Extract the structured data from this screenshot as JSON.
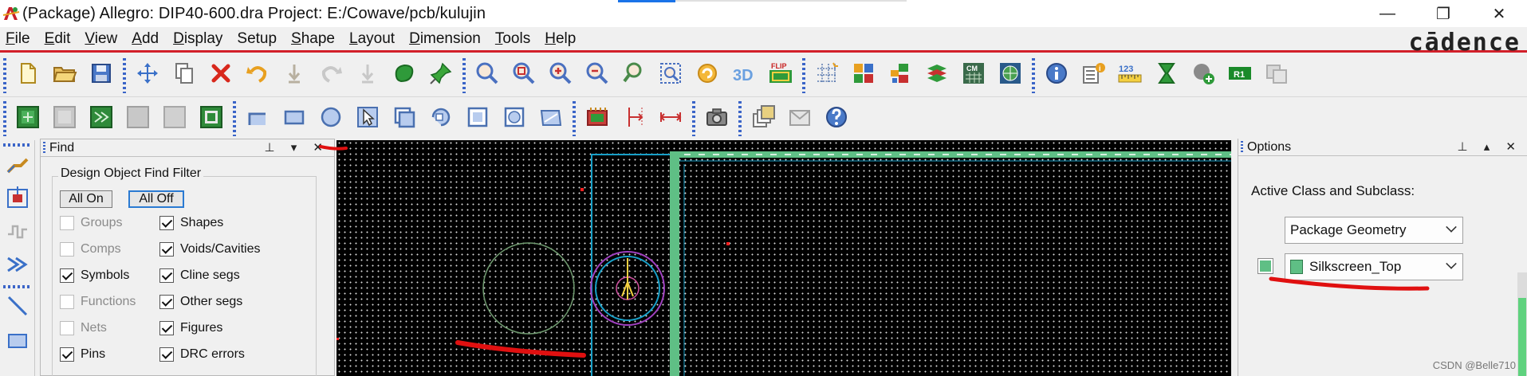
{
  "window": {
    "title": "(Package) Allegro: DIP40-600.dra  Project: E:/Cowave/pcb/kulujin",
    "minimize": "—",
    "restore": "❐",
    "close": "✕"
  },
  "menu": {
    "items": [
      {
        "label": "File",
        "accel": "F",
        "rest": "ile"
      },
      {
        "label": "Edit",
        "accel": "E",
        "rest": "dit"
      },
      {
        "label": "View",
        "accel": "V",
        "rest": "iew"
      },
      {
        "label": "Add",
        "accel": "A",
        "rest": "dd"
      },
      {
        "label": "Display",
        "accel": "D",
        "rest": "isplay"
      },
      {
        "label": "Setup",
        "accel": "",
        "rest": "Setup"
      },
      {
        "label": "Shape",
        "accel": "S",
        "rest": "hape"
      },
      {
        "label": "Layout",
        "accel": "L",
        "rest": "ayout"
      },
      {
        "label": "Dimension",
        "accel": "D",
        "rest": "imension"
      },
      {
        "label": "Tools",
        "accel": "T",
        "rest": "ools"
      },
      {
        "label": "Help",
        "accel": "H",
        "rest": "elp"
      }
    ],
    "brand": "cādence"
  },
  "toolbar1": {
    "icons": [
      "new-file-icon",
      "open-folder-icon",
      "save-icon",
      "move-icon",
      "copy-icon",
      "delete-icon",
      "undo-icon",
      "down-arrow-icon",
      "redo-icon",
      "down-arrow-icon",
      "green-blob-icon",
      "pin-icon",
      "zoom-fit-icon",
      "zoom-window-icon",
      "zoom-in-icon",
      "zoom-out-icon",
      "zoom-previous-icon",
      "zoom-world-icon",
      "redraw-icon",
      "3d-view-icon",
      "flip-icon",
      "grid-icon",
      "color-icon",
      "layers-icon",
      "stack-icon",
      "cm-icon",
      "world-icon",
      "info-icon",
      "properties-icon",
      "measure-123-icon",
      "hourglass-icon",
      "add-green-icon",
      "r1-icon",
      "disabled-icon"
    ],
    "label_3d": "3D",
    "label_flip": "FLIP",
    "label_cm": "CM",
    "label_123": "123",
    "label_r1": "R1"
  },
  "toolbar2": {
    "icons": [
      "place-green-icon",
      "place-gray-icon",
      "place-green2-icon",
      "place-gray2-icon",
      "place-gray3-icon",
      "place-green3-icon",
      "line-corner-icon",
      "rectangle-icon",
      "circle-icon",
      "select-arrow-icon",
      "shape-edit-icon",
      "rotate-shape-icon",
      "square-icon",
      "circle-square-icon",
      "shape-tool-icon",
      "component-icon",
      "dimension-vertical-icon",
      "dimension-horizontal-icon",
      "camera-icon",
      "multi-window-icon",
      "mail-icon",
      "help-icon"
    ]
  },
  "leftstrip": {
    "icons": [
      "route-icon",
      "place-icon",
      "signal-icon",
      "arrow-icon",
      "line-tool-icon",
      "rectangle-tool-icon"
    ]
  },
  "find": {
    "title": "Find",
    "controls": "⊥ ▾ ✕",
    "group_label": "Design Object Find Filter",
    "all_on": "All On",
    "all_off": "All Off",
    "left_col": [
      {
        "label": "Groups",
        "checked": false,
        "enabled": false
      },
      {
        "label": "Comps",
        "checked": false,
        "enabled": false
      },
      {
        "label": "Symbols",
        "checked": true,
        "enabled": true
      },
      {
        "label": "Functions",
        "checked": false,
        "enabled": false
      },
      {
        "label": "Nets",
        "checked": false,
        "enabled": false
      },
      {
        "label": "Pins",
        "checked": true,
        "enabled": true
      }
    ],
    "right_col": [
      {
        "label": "Shapes",
        "checked": true,
        "enabled": true
      },
      {
        "label": "Voids/Cavities",
        "checked": true,
        "enabled": true
      },
      {
        "label": "Cline segs",
        "checked": true,
        "enabled": true
      },
      {
        "label": "Other segs",
        "checked": true,
        "enabled": true
      },
      {
        "label": "Figures",
        "checked": true,
        "enabled": true
      },
      {
        "label": "DRC errors",
        "checked": true,
        "enabled": true
      }
    ]
  },
  "options": {
    "title": "Options",
    "controls": "⊥ ▴ ✕",
    "active_label": "Active Class and Subclass:",
    "class_value": "Package Geometry",
    "subclass_value": "Silkscreen_Top",
    "swatch_color": "#5fbf85"
  },
  "canvas": {
    "bg_color": "#000000",
    "grid_color": "#d8d8d8",
    "outline_color": "#18a0c8",
    "body_color": "#5fbf85",
    "pin_circle_color": "#6f9a6f",
    "pad_color": "#a040c0",
    "red_marker_color": "#ff2020"
  },
  "annotation_color": "#e01010",
  "watermark": "CSDN @Belle710"
}
